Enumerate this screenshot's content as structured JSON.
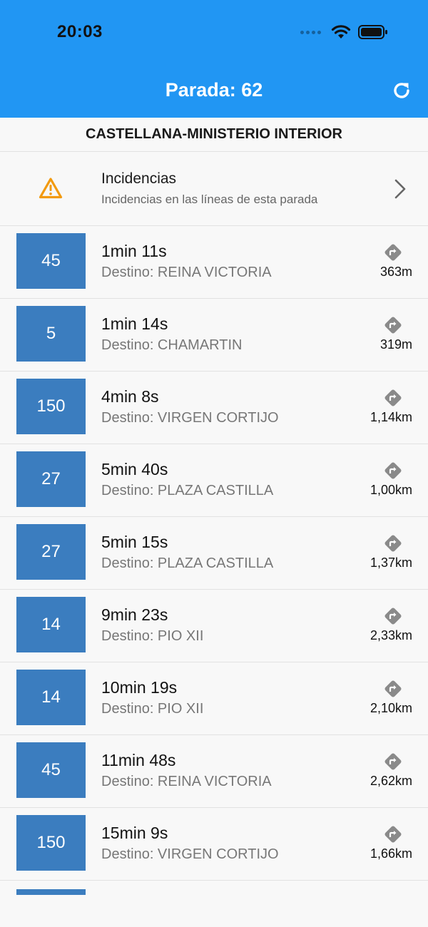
{
  "status": {
    "time": "20:03"
  },
  "header": {
    "title": "Parada: 62"
  },
  "stop": {
    "name": "CASTELLANA-MINISTERIO INTERIOR"
  },
  "incidents": {
    "title": "Incidencias",
    "subtitle": "Incidencias en las líneas de esta parada"
  },
  "arrivals": [
    {
      "line": "45",
      "time": "1min 11s",
      "destination": "Destino: REINA VICTORIA",
      "distance": "363m"
    },
    {
      "line": "5",
      "time": "1min 14s",
      "destination": "Destino: CHAMARTIN",
      "distance": "319m"
    },
    {
      "line": "150",
      "time": "4min 8s",
      "destination": "Destino: VIRGEN CORTIJO",
      "distance": "1,14km"
    },
    {
      "line": "27",
      "time": "5min 40s",
      "destination": "Destino: PLAZA CASTILLA",
      "distance": "1,00km"
    },
    {
      "line": "27",
      "time": "5min 15s",
      "destination": "Destino: PLAZA CASTILLA",
      "distance": "1,37km"
    },
    {
      "line": "14",
      "time": "9min 23s",
      "destination": "Destino: PIO XII",
      "distance": "2,33km"
    },
    {
      "line": "14",
      "time": "10min 19s",
      "destination": "Destino: PIO XII",
      "distance": "2,10km"
    },
    {
      "line": "45",
      "time": "11min 48s",
      "destination": "Destino: REINA VICTORIA",
      "distance": "2,62km"
    },
    {
      "line": "150",
      "time": "15min 9s",
      "destination": "Destino: VIRGEN CORTIJO",
      "distance": "1,66km"
    }
  ],
  "colors": {
    "primary": "#2196F3",
    "line_badge": "#3B7DBF",
    "warning": "#F29A0F",
    "direction_icon": "#8a8a8a"
  },
  "icons": {
    "refresh": "refresh-icon",
    "warning": "warning-icon",
    "chevron": "chevron-right-icon",
    "direction": "directions-icon"
  }
}
